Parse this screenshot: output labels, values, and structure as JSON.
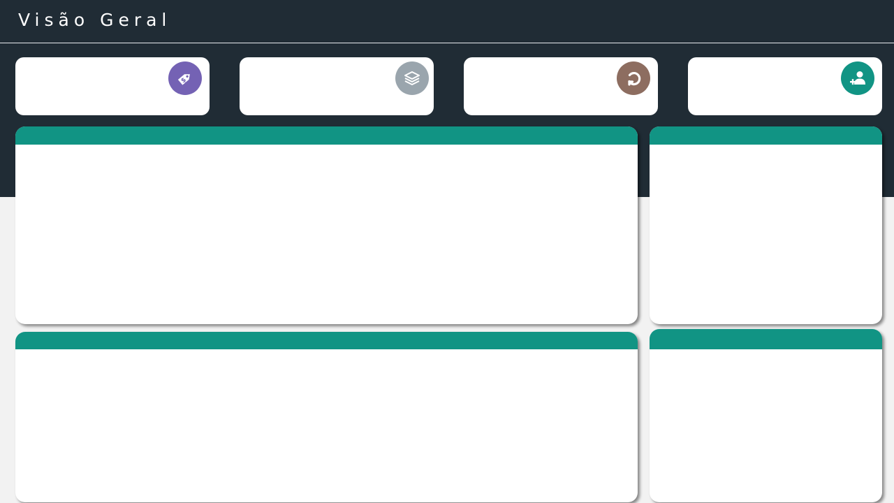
{
  "header": {
    "title": "Visão Geral"
  },
  "kpi_cards": [
    {
      "icon": "price-tag-dollar-icon",
      "icon_color": "#7462b4"
    },
    {
      "icon": "layers-icon",
      "icon_color": "#9aa5ad"
    },
    {
      "icon": "refresh-icon",
      "icon_color": "#8d6d60"
    },
    {
      "icon": "user-add-icon",
      "icon_color": "#119484"
    }
  ],
  "colors": {
    "header_bg": "#202c35",
    "page_bg": "#f2f2f2",
    "panel_header": "#119484",
    "card_bg": "#ffffff"
  }
}
